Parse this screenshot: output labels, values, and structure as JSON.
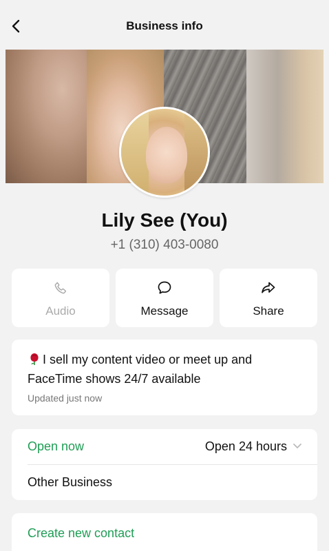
{
  "header": {
    "title": "Business info"
  },
  "profile": {
    "name": "Lily See (You)",
    "phone": "+1 (310) 403-0080"
  },
  "actions": [
    {
      "label": "Audio",
      "icon": "phone-icon",
      "enabled": false
    },
    {
      "label": "Message",
      "icon": "chat-bubble-icon",
      "enabled": true
    },
    {
      "label": "Share",
      "icon": "share-arrow-icon",
      "enabled": true
    }
  ],
  "description": {
    "emoji": "rose",
    "text": "I sell my content video or meet up and FaceTime shows 24/7 available",
    "updated": "Updated just now"
  },
  "status": {
    "open_now": "Open now",
    "hours": "Open 24 hours",
    "category": "Other Business"
  },
  "contact": {
    "create_label": "Create new contact"
  },
  "colors": {
    "background": "#f2f2f2",
    "accent_green": "#1f9d55",
    "card": "#ffffff",
    "muted_text": "#777777"
  }
}
